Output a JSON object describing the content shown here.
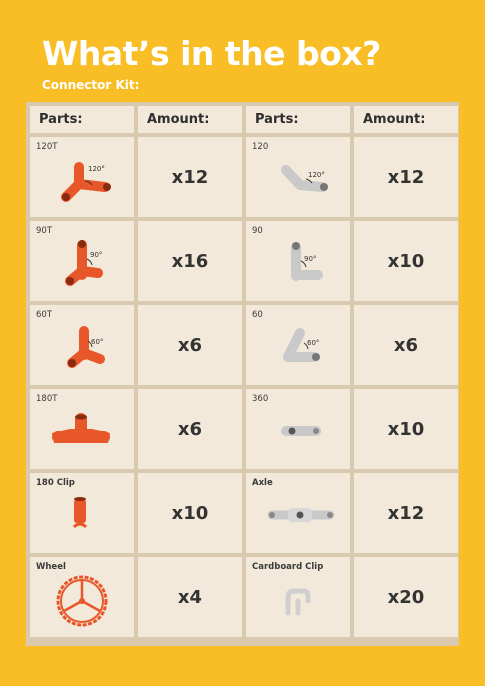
{
  "title": "What’s in the box?",
  "subtitle": "Connector Kit:",
  "headers": [
    "Parts:",
    "Amount:",
    "Parts:",
    "Amount:"
  ],
  "colors": {
    "background": "#F9BE25",
    "orange": "#E8572A",
    "grey": "#C9C9C9"
  },
  "rows": [
    {
      "left": {
        "name": "120T",
        "amount": "x12",
        "angle": "120°",
        "icon": "connector-120t-icon"
      },
      "right": {
        "name": "120",
        "amount": "x12",
        "angle": "120°",
        "icon": "connector-120-icon"
      }
    },
    {
      "left": {
        "name": "90T",
        "amount": "x16",
        "angle": "90°",
        "icon": "connector-90t-icon"
      },
      "right": {
        "name": "90",
        "amount": "x10",
        "angle": "90°",
        "icon": "connector-90-icon"
      }
    },
    {
      "left": {
        "name": "60T",
        "amount": "x6",
        "angle": "60°",
        "icon": "connector-60t-icon"
      },
      "right": {
        "name": "60",
        "amount": "x6",
        "angle": "60°",
        "icon": "connector-60-icon"
      }
    },
    {
      "left": {
        "name": "180T",
        "amount": "x6",
        "icon": "connector-180t-icon"
      },
      "right": {
        "name": "360",
        "amount": "x10",
        "icon": "connector-360-icon"
      }
    },
    {
      "left": {
        "name": "180 Clip",
        "amount": "x10",
        "icon": "clip-180-icon"
      },
      "right": {
        "name": "Axle",
        "amount": "x12",
        "icon": "axle-icon"
      }
    },
    {
      "left": {
        "name": "Wheel",
        "amount": "x4",
        "icon": "wheel-icon"
      },
      "right": {
        "name": "Cardboard Clip",
        "amount": "x20",
        "icon": "cardboard-clip-icon"
      }
    }
  ]
}
